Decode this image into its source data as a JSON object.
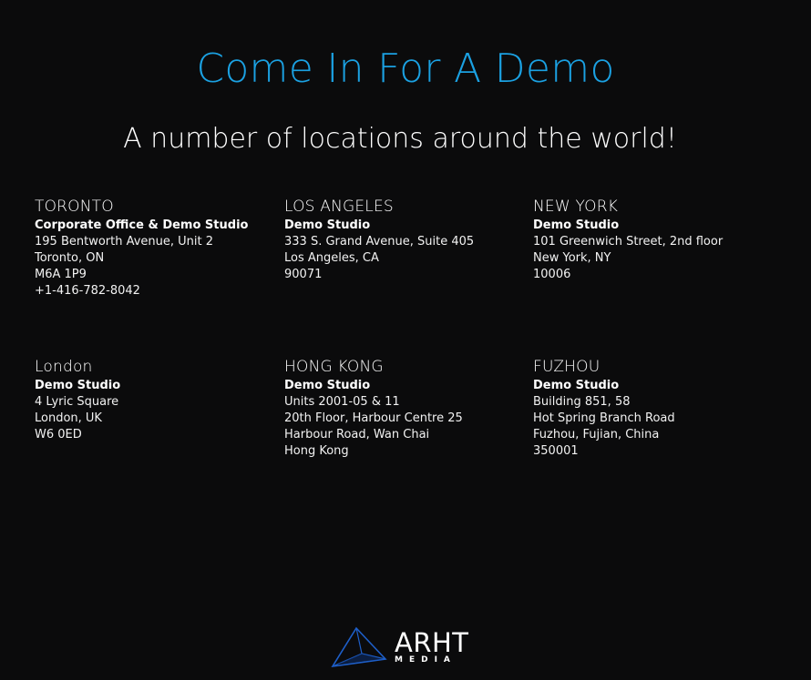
{
  "header": {
    "title": "Come In For A Demo",
    "subtitle": "A number of locations around the world!"
  },
  "colors": {
    "accent": "#1ba1e2",
    "background": "#0b0b0c",
    "text": "#ffffff"
  },
  "locations": [
    {
      "city": "TORONTO",
      "office": "Corporate Office & Demo Studio",
      "lines": [
        "195 Bentworth Avenue, Unit 2",
        "Toronto, ON",
        "M6A 1P9",
        "+1-416-782-8042"
      ]
    },
    {
      "city": "LOS ANGELES",
      "office": "Demo Studio",
      "lines": [
        "333 S. Grand Avenue, Suite 405",
        "Los Angeles, CA",
        "90071"
      ]
    },
    {
      "city": "NEW YORK",
      "office": "Demo Studio",
      "lines": [
        "101 Greenwich Street, 2nd floor",
        "New York, NY",
        "10006"
      ]
    },
    {
      "city": "London",
      "office": "Demo Studio",
      "lines": [
        "4 Lyric Square",
        "London, UK",
        "W6 0ED"
      ]
    },
    {
      "city": "HONG KONG",
      "office": "Demo Studio",
      "lines": [
        "Units 2001-05 & 11",
        "20th Floor, Harbour Centre 25",
        "Harbour Road, Wan Chai",
        "Hong Kong"
      ]
    },
    {
      "city": "FUZHOU",
      "office": "Demo Studio",
      "lines": [
        "Building 851, 58",
        "Hot Spring Branch Road",
        "Fuzhou, Fujian, China",
        "350001"
      ]
    }
  ],
  "footer": {
    "logo_icon": "arht-triangle-logo-icon",
    "logo_text": "ARHT",
    "logo_subtext": "MEDIA"
  }
}
